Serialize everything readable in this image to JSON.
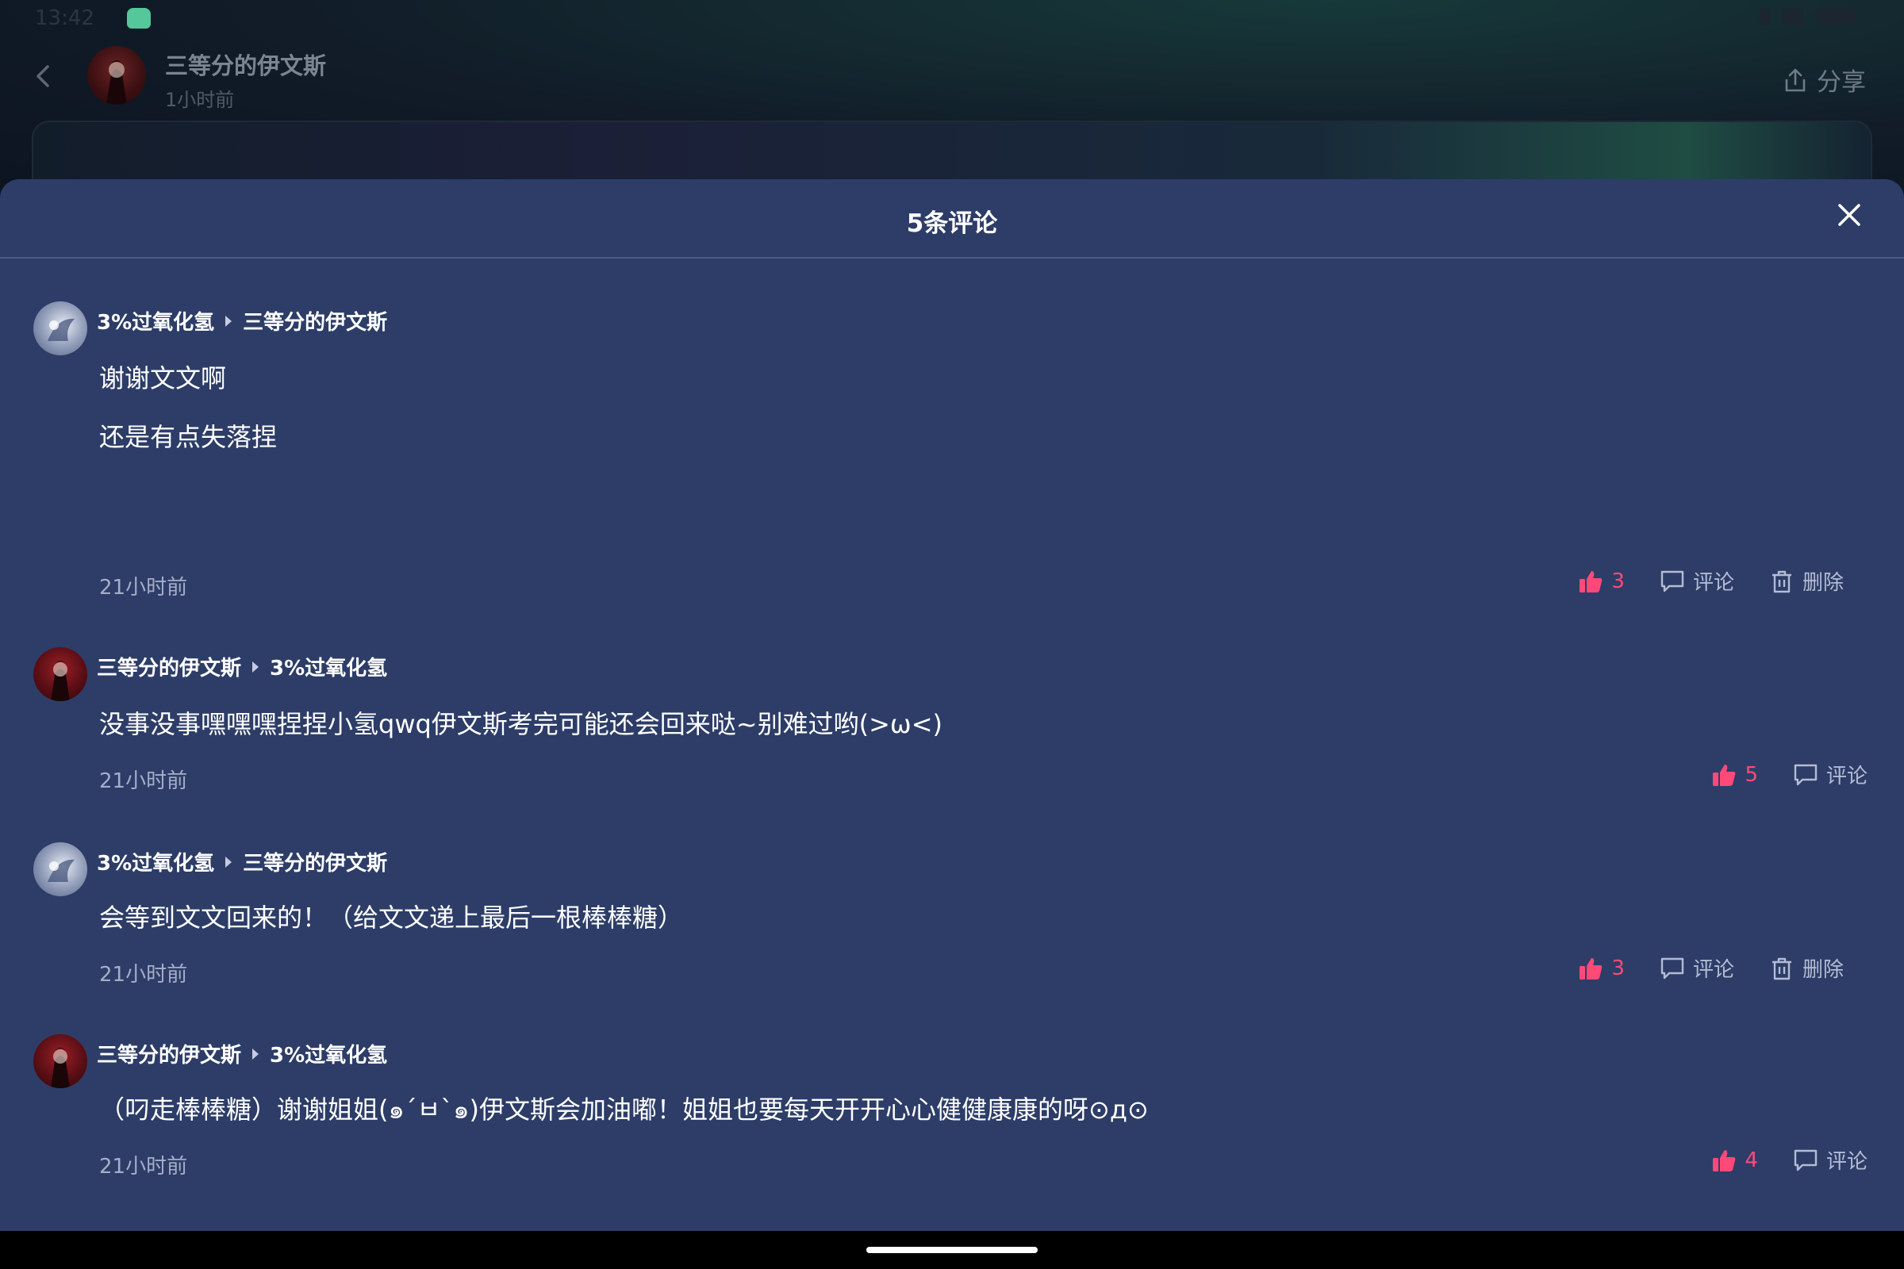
{
  "status_bar": {
    "time": "13:42"
  },
  "header": {
    "author_name": "三等分的伊文斯",
    "post_time": "1小时前",
    "share_label": "分享"
  },
  "sheet": {
    "title": "5条评论"
  },
  "colors": {
    "sheet_bg": "#2d3d68",
    "like_accent": "#ff4a78",
    "secondary_text": "#a5aec8"
  },
  "comments": [
    {
      "author": "3%过氧化氢",
      "reply_to": "三等分的伊文斯",
      "lines": [
        "谢谢文文啊",
        "还是有点失落捏"
      ],
      "time": "21小时前",
      "likes": "3",
      "comment_label": "评论",
      "delete_label": "删除"
    },
    {
      "author": "三等分的伊文斯",
      "reply_to": "3%过氧化氢",
      "lines": [
        "没事没事嘿嘿嘿捏捏小氢qwq伊文斯考完可能还会回来哒~别难过哟(>ω<)"
      ],
      "time": "21小时前",
      "likes": "5",
      "comment_label": "评论"
    },
    {
      "author": "3%过氧化氢",
      "reply_to": "三等分的伊文斯",
      "lines": [
        "会等到文文回来的！（给文文递上最后一根棒棒糖）"
      ],
      "time": "21小时前",
      "likes": "3",
      "comment_label": "评论",
      "delete_label": "删除"
    },
    {
      "author": "三等分的伊文斯",
      "reply_to": "3%过氧化氢",
      "lines": [
        "（叼走棒棒糖）谢谢姐姐(๑´ㅂ`๑)伊文斯会加油嘟！姐姐也要每天开开心心健健康康的呀⊙д⊙"
      ],
      "time": "21小时前",
      "likes": "4",
      "comment_label": "评论"
    }
  ]
}
